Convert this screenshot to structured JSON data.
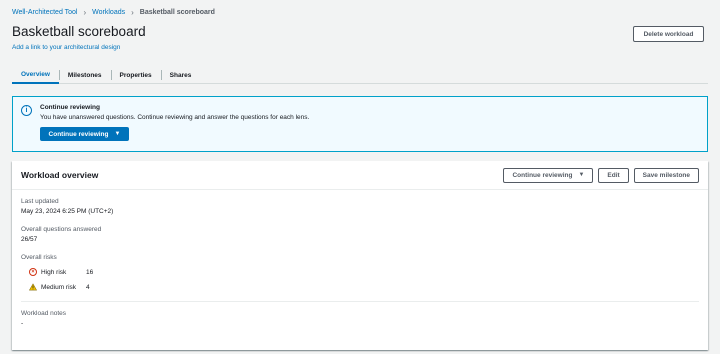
{
  "breadcrumb": [
    "Well-Architected Tool",
    "Workloads",
    "Basketball scoreboard"
  ],
  "page": {
    "title": "Basketball scoreboard",
    "sub_link": "Add a link to your architectural design",
    "delete_label": "Delete workload"
  },
  "tabs": [
    "Overview",
    "Milestones",
    "Properties",
    "Shares"
  ],
  "flash": {
    "title": "Continue reviewing",
    "text": "You have unanswered questions. Continue reviewing and answer the questions for each lens.",
    "button": "Continue reviewing"
  },
  "overview": {
    "title": "Workload overview",
    "actions": {
      "continue": "Continue reviewing",
      "edit": "Edit",
      "milestone": "Save milestone"
    },
    "last_updated_label": "Last updated",
    "last_updated_value": "May 23, 2024 6:25 PM (UTC+2)",
    "questions_label": "Overall questions answered",
    "questions_value": "26/57",
    "risks_label": "Overall risks",
    "risks": [
      {
        "label": "High risk",
        "count": "16"
      },
      {
        "label": "Medium risk",
        "count": "4"
      }
    ],
    "notes_label": "Workload notes",
    "notes_value": "-"
  },
  "colors": {
    "link": "#0073bb",
    "high_risk": "#d13212",
    "medium_risk": "#f2c200",
    "background": "#f2f3f3"
  },
  "icons": [
    "chevron-right-icon",
    "info-icon",
    "caret-down-icon",
    "high-risk-icon",
    "warning-icon"
  ]
}
